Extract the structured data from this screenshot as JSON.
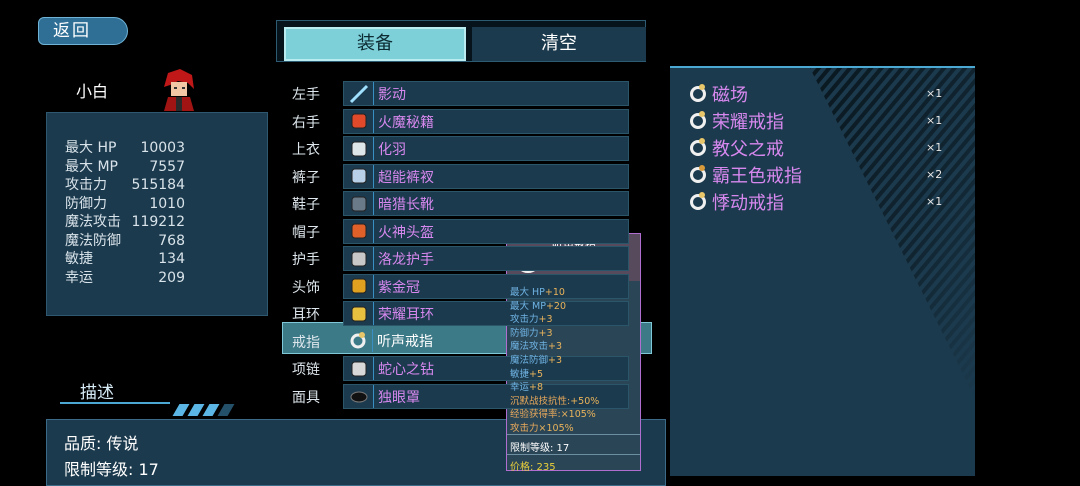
{
  "top": {
    "back_label": "返回"
  },
  "hero": {
    "name": "小白"
  },
  "stats": [
    {
      "label": "最大 HP",
      "value": "10003"
    },
    {
      "label": "最大 MP",
      "value": "7557"
    },
    {
      "label": "攻击力",
      "value": "515184"
    },
    {
      "label": "防御力",
      "value": "1010"
    },
    {
      "label": "魔法攻击",
      "value": "119212"
    },
    {
      "label": "魔法防御",
      "value": "768"
    },
    {
      "label": "敏捷",
      "value": "134"
    },
    {
      "label": "幸运",
      "value": "209"
    }
  ],
  "tabs": {
    "equip": "装备",
    "clear": "清空"
  },
  "slots": [
    {
      "slot": "左手",
      "item": "影动",
      "color": "#d788ef",
      "icon": "sword-icon"
    },
    {
      "slot": "右手",
      "item": "火魔秘籍",
      "color": "#d788ef",
      "icon": "book-icon"
    },
    {
      "slot": "上衣",
      "item": "化羽",
      "color": "#d788ef",
      "icon": "armor-icon"
    },
    {
      "slot": "裤子",
      "item": "超能裤衩",
      "color": "#d788ef",
      "icon": "pants-icon"
    },
    {
      "slot": "鞋子",
      "item": "暗猎长靴",
      "color": "#d788ef",
      "icon": "boots-icon"
    },
    {
      "slot": "帽子",
      "item": "火神头盔",
      "color": "#d788ef",
      "icon": "helmet-icon"
    },
    {
      "slot": "护手",
      "item": "洛龙护手",
      "color": "#d788ef",
      "icon": "gauntlet-icon"
    },
    {
      "slot": "头饰",
      "item": "紫金冠",
      "color": "#d788ef",
      "icon": "crown-icon"
    },
    {
      "slot": "耳环",
      "item": "荣耀耳环",
      "color": "#d788ef",
      "icon": "earring-icon"
    },
    {
      "slot": "戒指",
      "item": "听声戒指",
      "color": "#ffffff",
      "icon": "ring-icon"
    },
    {
      "slot": "项链",
      "item": "蛇心之钻",
      "color": "#d788ef",
      "icon": "necklace-icon"
    },
    {
      "slot": "面具",
      "item": "独眼罩",
      "color": "#d788ef",
      "icon": "eyepatch-icon"
    }
  ],
  "inventory": [
    {
      "name": "磁场",
      "count": "×1"
    },
    {
      "name": "荣耀戒指",
      "count": "×1"
    },
    {
      "name": "教父之戒",
      "count": "×1"
    },
    {
      "name": "霸王色戒指",
      "count": "×2"
    },
    {
      "name": "悸动戒指",
      "count": "×1"
    }
  ],
  "tooltip": {
    "title": "听声戒指",
    "type": "戒指",
    "lines": [
      {
        "label": "最大 HP",
        "bonus": "+10"
      },
      {
        "label": "最大 MP",
        "bonus": "+20"
      },
      {
        "label": "攻击力",
        "bonus": "+3"
      },
      {
        "label": "防御力",
        "bonus": "+3"
      },
      {
        "label": "魔法攻击",
        "bonus": "+3"
      },
      {
        "label": "魔法防御",
        "bonus": "+3"
      },
      {
        "label": "敏捷",
        "bonus": "+5"
      },
      {
        "label": "幸运",
        "bonus": "+8"
      },
      {
        "label": "沉默战技抗性:",
        "bonus": "+50%"
      },
      {
        "label": "经验获得率:",
        "bonus": "×105%"
      },
      {
        "label": "攻击力",
        "bonus": "×105%"
      }
    ],
    "limit": "限制等级: 17",
    "price": "价格: 235"
  },
  "desc": {
    "title": "描述",
    "quality": "品质: 传说",
    "limit": "限制等级: 17"
  }
}
